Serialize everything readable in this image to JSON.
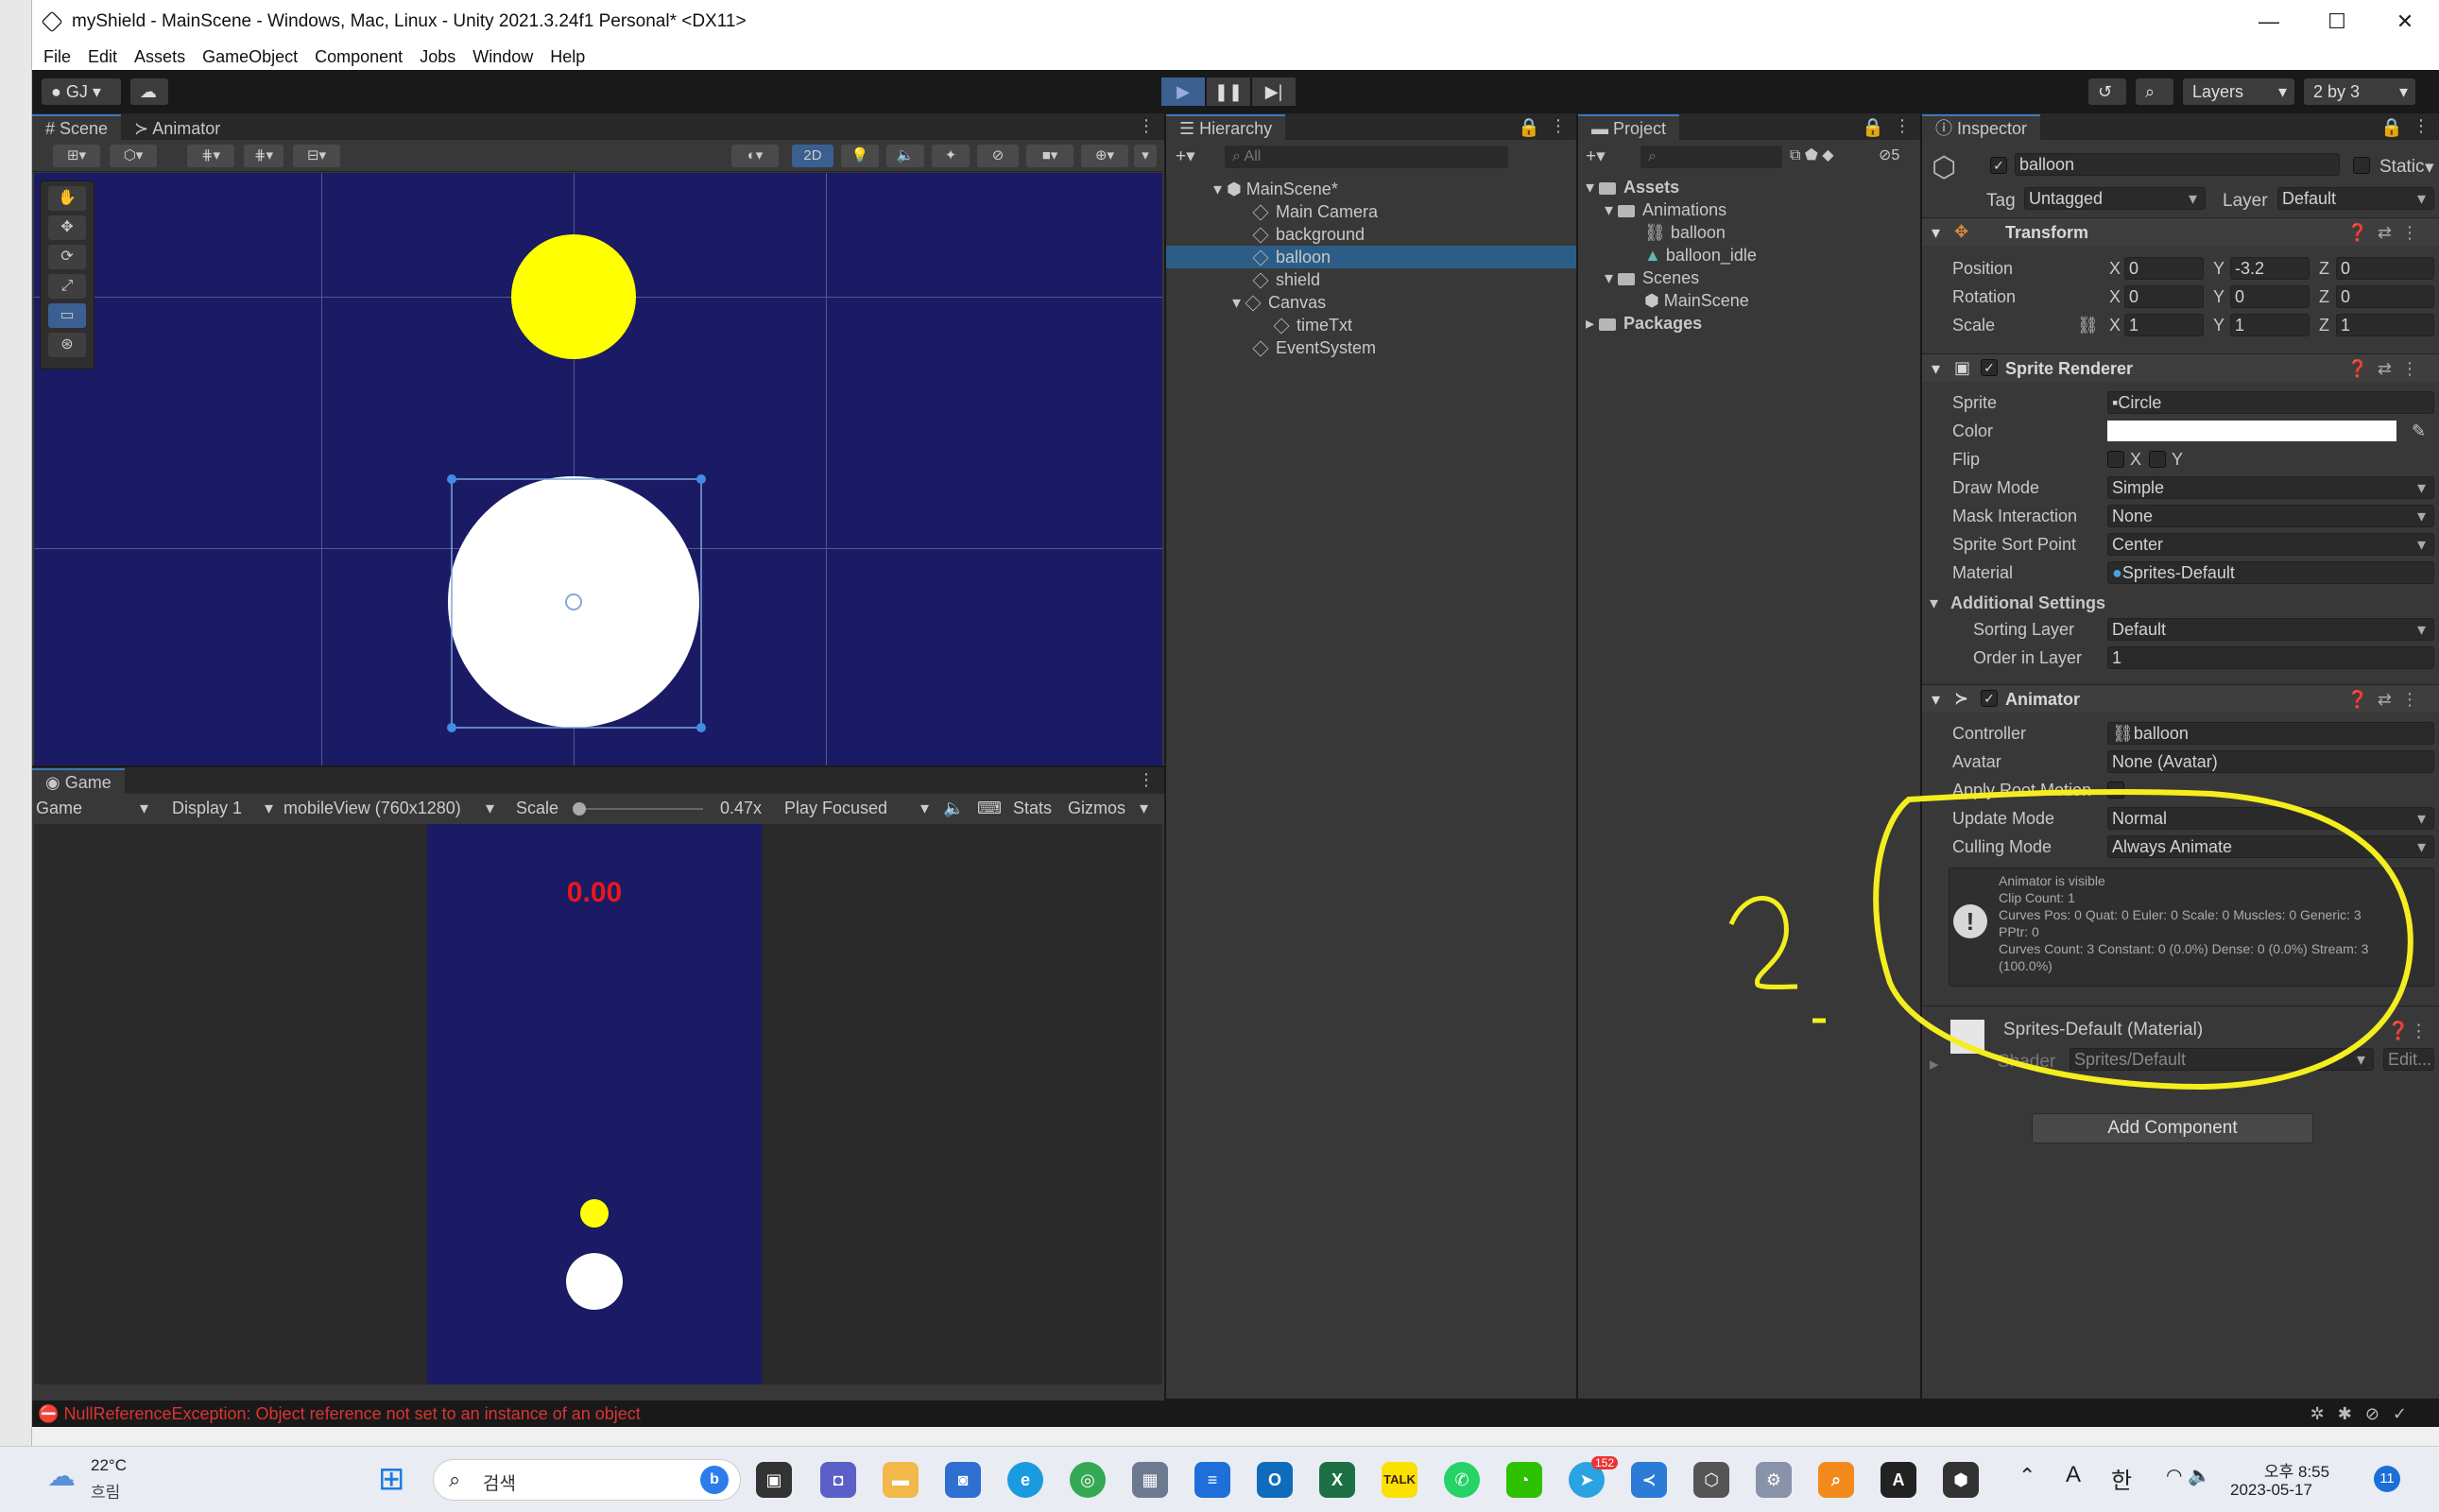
{
  "window": {
    "title": "myShield - MainScene - Windows, Mac, Linux - Unity 2021.3.24f1 Personal* <DX11>",
    "controls": [
      "—",
      "☐",
      "✕"
    ]
  },
  "menu": [
    "File",
    "Edit",
    "Assets",
    "GameObject",
    "Component",
    "Jobs",
    "Window",
    "Help"
  ],
  "toolbar": {
    "account": "GJ",
    "layers_label": "Layers",
    "layout_label": "2 by 3"
  },
  "scene": {
    "tab_scene": "Scene",
    "tab_animator": "Animator",
    "btn_2d": "2D"
  },
  "game": {
    "tab": "Game",
    "game_dropdown": "Game",
    "display": "Display 1",
    "resolution": "mobileView (760x1280)",
    "scale_label": "Scale",
    "scale_value": "0.47x",
    "play_focused": "Play Focused",
    "stats": "Stats",
    "gizmos": "Gizmos",
    "timer_text": "0.00"
  },
  "hierarchy": {
    "tab": "Hierarchy",
    "search_placeholder": "All",
    "scene_name": "MainScene*",
    "items": [
      "Main Camera",
      "background",
      "balloon",
      "shield",
      "Canvas",
      "timeTxt",
      "EventSystem"
    ]
  },
  "project": {
    "tab": "Project",
    "badge": "5",
    "items": [
      "Assets",
      "Animations",
      "balloon",
      "balloon_idle",
      "Scenes",
      "MainScene",
      "Packages"
    ]
  },
  "inspector": {
    "tab": "Inspector",
    "object_name": "balloon",
    "static_label": "Static",
    "tag_label": "Tag",
    "tag_value": "Untagged",
    "layer_label": "Layer",
    "layer_value": "Default",
    "transform": {
      "title": "Transform",
      "position_label": "Position",
      "rotation_label": "Rotation",
      "scale_label": "Scale",
      "position": [
        "0",
        "-3.2",
        "0"
      ],
      "rotation": [
        "0",
        "0",
        "0"
      ],
      "scale": [
        "1",
        "1",
        "1"
      ]
    },
    "sprite_renderer": {
      "title": "Sprite Renderer",
      "sprite_label": "Sprite",
      "sprite_value": "Circle",
      "color_label": "Color",
      "flip_label": "Flip",
      "flip_x": "X",
      "flip_y": "Y",
      "draw_mode_label": "Draw Mode",
      "draw_mode_value": "Simple",
      "mask_label": "Mask Interaction",
      "mask_value": "None",
      "sort_point_label": "Sprite Sort Point",
      "sort_point_value": "Center",
      "material_label": "Material",
      "material_value": "Sprites-Default",
      "additional_label": "Additional Settings",
      "sorting_layer_label": "Sorting Layer",
      "sorting_layer_value": "Default",
      "order_label": "Order in Layer",
      "order_value": "1"
    },
    "animator": {
      "title": "Animator",
      "controller_label": "Controller",
      "controller_value": "balloon",
      "avatar_label": "Avatar",
      "avatar_value": "None (Avatar)",
      "root_motion_label": "Apply Root Motion",
      "update_mode_label": "Update Mode",
      "update_mode_value": "Normal",
      "culling_label": "Culling Mode",
      "culling_value": "Always Animate",
      "info_lines": [
        "Animator is visible",
        "Clip Count: 1",
        "Curves Pos: 0 Quat: 0 Euler: 0 Scale: 0 Muscles: 0 Generic: 3",
        "PPtr: 0",
        "Curves Count: 3 Constant: 0 (0.0%) Dense: 0 (0.0%) Stream: 3",
        "(100.0%)"
      ]
    },
    "material": {
      "title": "Sprites-Default (Material)",
      "shader_label": "Shader",
      "shader_value": "Sprites/Default",
      "edit_label": "Edit..."
    },
    "add_component": "Add Component"
  },
  "console_error": "NullReferenceException: Object reference not set to an instance of an object",
  "taskbar": {
    "weather_temp": "22°C",
    "weather_desc": "흐림",
    "search_placeholder": "검색",
    "clock_time": "오후 8:55",
    "clock_date": "2023-05-17",
    "ime_a": "A",
    "ime_han": "한",
    "notif_count": "11",
    "telegram_badge": "152"
  },
  "colors": {
    "scene_bg": "#1a1b64",
    "balloon_yellow": "#ffff00",
    "annotation_yellow": "#f5ee1e",
    "selection_blue": "#2c5d87",
    "error_red": "#dd3333"
  }
}
